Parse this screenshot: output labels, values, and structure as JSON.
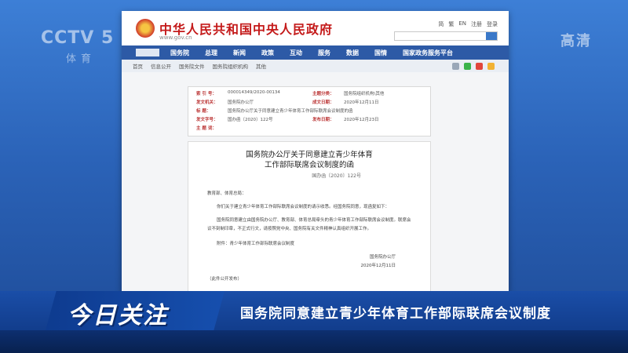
{
  "broadcast": {
    "logo": "CCTV 5",
    "logo_sub": "体育",
    "hd_label": "高清"
  },
  "site": {
    "title": "中华人民共和国中央人民政府",
    "url": "www.gov.cn",
    "top_links": [
      "简",
      "繁",
      "EN",
      "注册",
      "登录"
    ],
    "nav": [
      "国务院",
      "总理",
      "新闻",
      "政策",
      "互动",
      "服务",
      "数据",
      "国情",
      "国家政务服务平台"
    ]
  },
  "breadcrumb": [
    "首页",
    "信息公开",
    "国务院文件",
    "国务院组织机构",
    "其他"
  ],
  "meta": [
    {
      "k": "索  引  号：",
      "v": "000014349/2020-00134"
    },
    {
      "k": "主题分类：",
      "v": "国务院组织机构\\其他"
    },
    {
      "k": "发文机关：",
      "v": "国务院办公厅"
    },
    {
      "k": "成文日期：",
      "v": "2020年12月11日"
    },
    {
      "k": "标      题：",
      "v": "国务院办公厅关于同意建立青少年体育工作部际联席会议制度的函"
    },
    {
      "k": "",
      "v": ""
    },
    {
      "k": "发文字号：",
      "v": "国办函〔2020〕122号"
    },
    {
      "k": "发布日期：",
      "v": "2020年12月23日"
    },
    {
      "k": "主  题  词：",
      "v": ""
    }
  ],
  "doc": {
    "title_line1": "国务院办公厅关于同意建立青少年体育",
    "title_line2": "工作部际联席会议制度的函",
    "number": "国办函〔2020〕122号",
    "p1": "教育部、体育总局：",
    "p2": "你们关于建立青少年体育工作部际联席会议制度的请示收悉。经国务院同意，现函复如下：",
    "p3": "国务院同意建立由国务院办公厅、教育部、体育总局牵头的青少年体育工作部际联席会议制度。联席会议不刻制印章，不正式行文，请按照党中央、国务院有关文件精神认真组织开展工作。",
    "attachment": "附件：青少年体育工作部际联席会议制度",
    "sign": "国务院办公厅",
    "date": "2020年12月11日",
    "note": "（此件公开发布）"
  },
  "banner": {
    "logo": "今日关注",
    "headline": "国务院同意建立青少年体育工作部际联席会议制度"
  }
}
